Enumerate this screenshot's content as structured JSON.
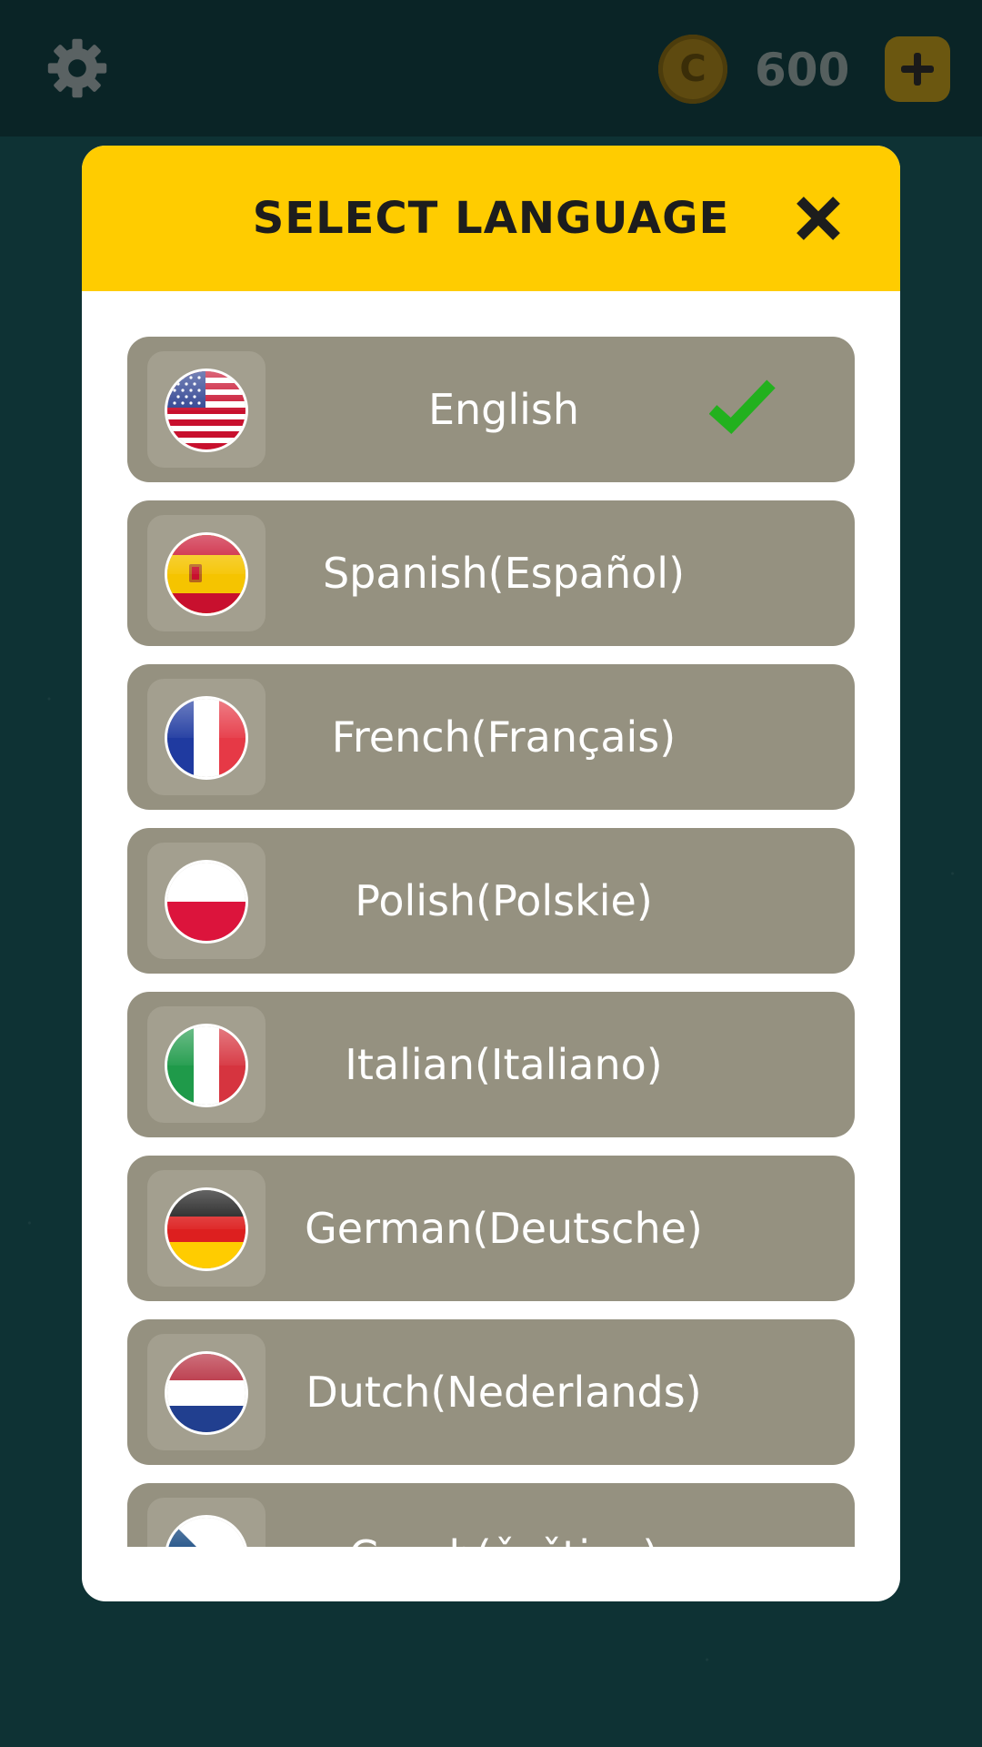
{
  "topbar": {
    "settings_icon": "gear-icon",
    "coin_icon": "coin-icon",
    "coin_symbol": "C",
    "coins": "600",
    "add_icon": "plus-icon"
  },
  "modal": {
    "title": "SELECT LANGUAGE",
    "close_icon": "close-icon"
  },
  "languages": [
    {
      "label": "English",
      "flag": "us-flag-icon",
      "selected": true
    },
    {
      "label": "Spanish(Español)",
      "flag": "spain-flag-icon",
      "selected": false
    },
    {
      "label": "French(Français)",
      "flag": "france-flag-icon",
      "selected": false
    },
    {
      "label": "Polish(Polskie)",
      "flag": "poland-flag-icon",
      "selected": false
    },
    {
      "label": "Italian(Italiano)",
      "flag": "italy-flag-icon",
      "selected": false
    },
    {
      "label": "German(Deutsche)",
      "flag": "germany-flag-icon",
      "selected": false
    },
    {
      "label": "Dutch(Nederlands)",
      "flag": "netherlands-flag-icon",
      "selected": false
    },
    {
      "label": "Czech(čeština)",
      "flag": "czech-flag-icon",
      "selected": false
    }
  ],
  "colors": {
    "header": "#ffcc00",
    "row": "#959180",
    "check": "#22b11e",
    "background": "#0e3234"
  }
}
